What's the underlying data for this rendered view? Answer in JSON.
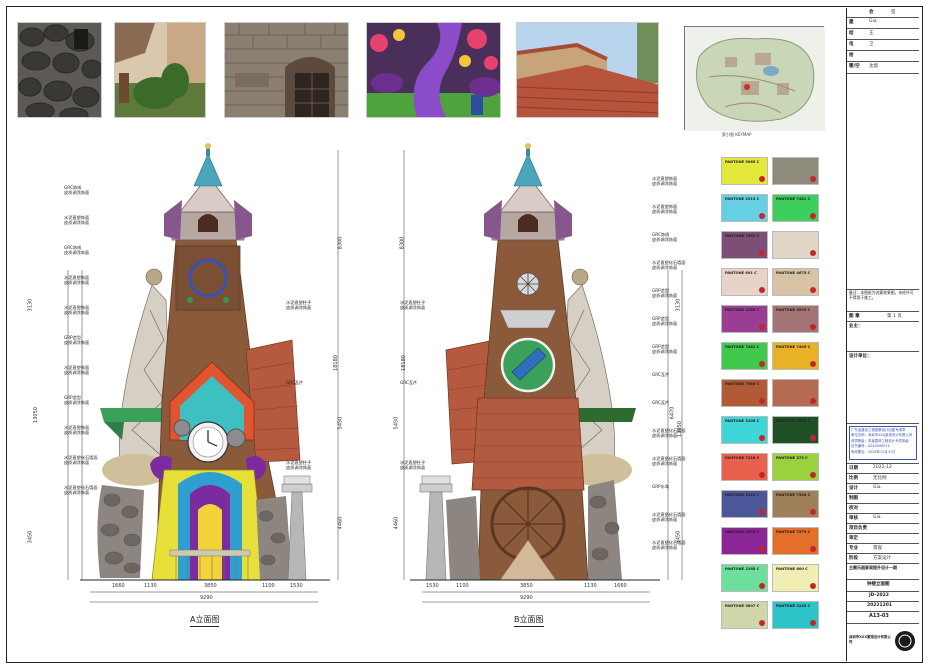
{
  "elevation_a": {
    "caption": "A立面图",
    "annotations": [
      {
        "text": "GRC饰线",
        "sub": "皮质调涂饰面"
      },
      {
        "text": "水泥直塑饰面",
        "sub": "皮质调涂饰面"
      },
      {
        "text": "GRC饰线",
        "sub": "皮质调涂饰面"
      },
      {
        "text": "水泥直塑饰面",
        "sub": "皮质调涂饰面"
      },
      {
        "text": "水泥直塑饰面",
        "sub": "皮质调涂饰面"
      },
      {
        "text": "GRP造型",
        "sub": "皮质调涂饰面"
      },
      {
        "text": "水泥直塑饰面",
        "sub": "皮质调涂饰面"
      },
      {
        "text": "GRP造型",
        "sub": "皮质调涂饰面"
      },
      {
        "text": "水泥直塑饰面",
        "sub": "皮质调涂饰面"
      },
      {
        "text": "水泥直塑化石墙面",
        "sub": "皮质调涂饰面"
      },
      {
        "text": "水泥直塑化石墙面",
        "sub": "皮质调涂饰面"
      }
    ],
    "right_annotations": [
      {
        "text": "水泥直塑柱子",
        "sub": "皮质调涂饰面"
      },
      {
        "text": "GRC瓦片",
        "sub": ""
      },
      {
        "text": "水泥直塑柱子",
        "sub": "皮质调涂饰面"
      }
    ],
    "bottom_dims": [
      "1660",
      "1130",
      "3850",
      "1100",
      "1530"
    ],
    "total_dim": "9290",
    "left_dims": [
      "3130",
      "13050",
      "3450"
    ],
    "right_dims": [
      "8300",
      "18180",
      "5450",
      "4460"
    ]
  },
  "elevation_b": {
    "caption": "B立面图",
    "annotations": [
      {
        "text": "水泥直塑饰面",
        "sub": "皮质调涂饰面"
      },
      {
        "text": "水泥直塑饰面",
        "sub": "皮质调涂饰面"
      },
      {
        "text": "GRC饰线",
        "sub": "皮质调涂饰面"
      },
      {
        "text": "水泥直塑化石墙面",
        "sub": "皮质调涂饰面"
      },
      {
        "text": "GRP造型",
        "sub": "皮质调涂饰面"
      },
      {
        "text": "GRP造型",
        "sub": "皮质调涂饰面"
      },
      {
        "text": "GRP造型",
        "sub": "皮质调涂饰面"
      },
      {
        "text": "GRC瓦片",
        "sub": ""
      },
      {
        "text": "GRC瓦片",
        "sub": ""
      },
      {
        "text": "水泥直塑化石墙面",
        "sub": "皮质调涂饰面"
      },
      {
        "text": "水泥直塑化石墙面",
        "sub": "皮质调涂饰面"
      },
      {
        "text": "GRP水车",
        "sub": ""
      },
      {
        "text": "水泥直塑化石墙面",
        "sub": "皮质调涂饰面"
      },
      {
        "text": "水泥直塑化石墙面",
        "sub": "皮质调涂饰面"
      }
    ],
    "left_annotations": [
      {
        "text": "水泥直塑柱子",
        "sub": "皮质调涂饰面"
      },
      {
        "text": "GRC瓦片",
        "sub": ""
      },
      {
        "text": "水泥直塑柱子",
        "sub": "皮质调涂饰面"
      }
    ],
    "bottom_dims": [
      "1530",
      "1100",
      "3850",
      "1130",
      "1660"
    ],
    "total_dim": "9290",
    "left_dims": [
      "8300",
      "18180",
      "5450",
      "4460"
    ],
    "right_dims": [
      "3130",
      "6470",
      "13050",
      "3450"
    ]
  },
  "keymap": {
    "caption": "索引图 KEYMAP"
  },
  "swatches": [
    {
      "code": "PANTONE 3965 C",
      "color": "#e3e83a"
    },
    {
      "code": "",
      "color": "#8e8a7c"
    },
    {
      "code": "PANTONE 2915 C",
      "color": "#66cfe3"
    },
    {
      "code": "PANTONE 7481 C",
      "color": "#3ccf5c"
    },
    {
      "code": "PANTONE 7652 C",
      "color": "#7d4f77"
    },
    {
      "code": "",
      "color": "#e2d6c6"
    },
    {
      "code": "PANTONE 691 C",
      "color": "#e9d2c7"
    },
    {
      "code": "PANTONE 4675 C",
      "color": "#d8c3a6"
    },
    {
      "code": "PANTONE 2385 C",
      "color": "#9b3d93"
    },
    {
      "code": "PANTONE 4995 C",
      "color": "#a37475"
    },
    {
      "code": "PANTONE 7482 C",
      "color": "#41c94e"
    },
    {
      "code": "PANTONE 7409 C",
      "color": "#e9b125"
    },
    {
      "code": "PANTONE 7580 C",
      "color": "#b25a35"
    },
    {
      "code": "",
      "color": "#b56a52"
    },
    {
      "code": "PANTONE 3105 C",
      "color": "#3fd6d8"
    },
    {
      "code": "PANTONE 3435 C",
      "color": "#1f5128"
    },
    {
      "code": "PANTONE 7416 C",
      "color": "#e9614d"
    },
    {
      "code": "PANTONE 375 C",
      "color": "#9ad13c"
    },
    {
      "code": "PANTONE 2110 C",
      "color": "#4c5799"
    },
    {
      "code": "PANTONE 7505 C",
      "color": "#a0805a"
    },
    {
      "code": "PANTONE 2593 C",
      "color": "#8c2595"
    },
    {
      "code": "PANTONE 7579 C",
      "color": "#e36f2a"
    },
    {
      "code": "PANTONE 2268 C",
      "color": "#6ce09a"
    },
    {
      "code": "PANTONE 600 C",
      "color": "#f1eeb3"
    },
    {
      "code": "PANTONE 5807 C",
      "color": "#cfd6a9"
    },
    {
      "code": "PANTONE 3245 C",
      "color": "#2cc3c9"
    }
  ],
  "title_block": {
    "rows": [
      {
        "label": "会",
        "value": "签"
      },
      {
        "label": "建",
        "value": "Gia."
      },
      {
        "label": "结",
        "value": "王"
      },
      {
        "label": "电",
        "value": "卫"
      },
      {
        "label": "给",
        "value": ""
      },
      {
        "label": "暖/空",
        "value": "沈恩"
      }
    ],
    "notes": "备注：本图纸为创意效果图，未经许可不得用于施工。",
    "seal_label": "图 章",
    "sheet_no": "第 1 页",
    "project_label": "业主：",
    "design_label": "设计单位：",
    "stamp_lines": [
      "广东省建设工程勘察设计出图专用章",
      "单位名称：深圳市XXX景观设计有限公司",
      "资质等级：风景园林工程设计专项甲级",
      "证书编号：A244008574",
      "有效期至：2026年12月31日"
    ],
    "date": "2022-12",
    "scale": "无比例",
    "fields": [
      {
        "label": "日期",
        "value": "2022-12"
      },
      {
        "label": "比例",
        "value": "无比例"
      },
      {
        "label": "设计",
        "value": "Gia."
      },
      {
        "label": "制图",
        "value": ""
      },
      {
        "label": "校对",
        "value": ""
      },
      {
        "label": "审核",
        "value": "Gia."
      },
      {
        "label": "项目负责",
        "value": ""
      },
      {
        "label": "审定",
        "value": ""
      },
      {
        "label": "专业",
        "value": "景观"
      },
      {
        "label": "阶段",
        "value": "方案设计"
      }
    ],
    "project_name": "主题乐园景观提升设计一期",
    "drawing_name": "钟楼立面图",
    "job_no": "JD-2022",
    "drawing_no": "20221201",
    "sheet_code": "A13-03",
    "company": "深圳市XXX景观设计有限公司"
  }
}
